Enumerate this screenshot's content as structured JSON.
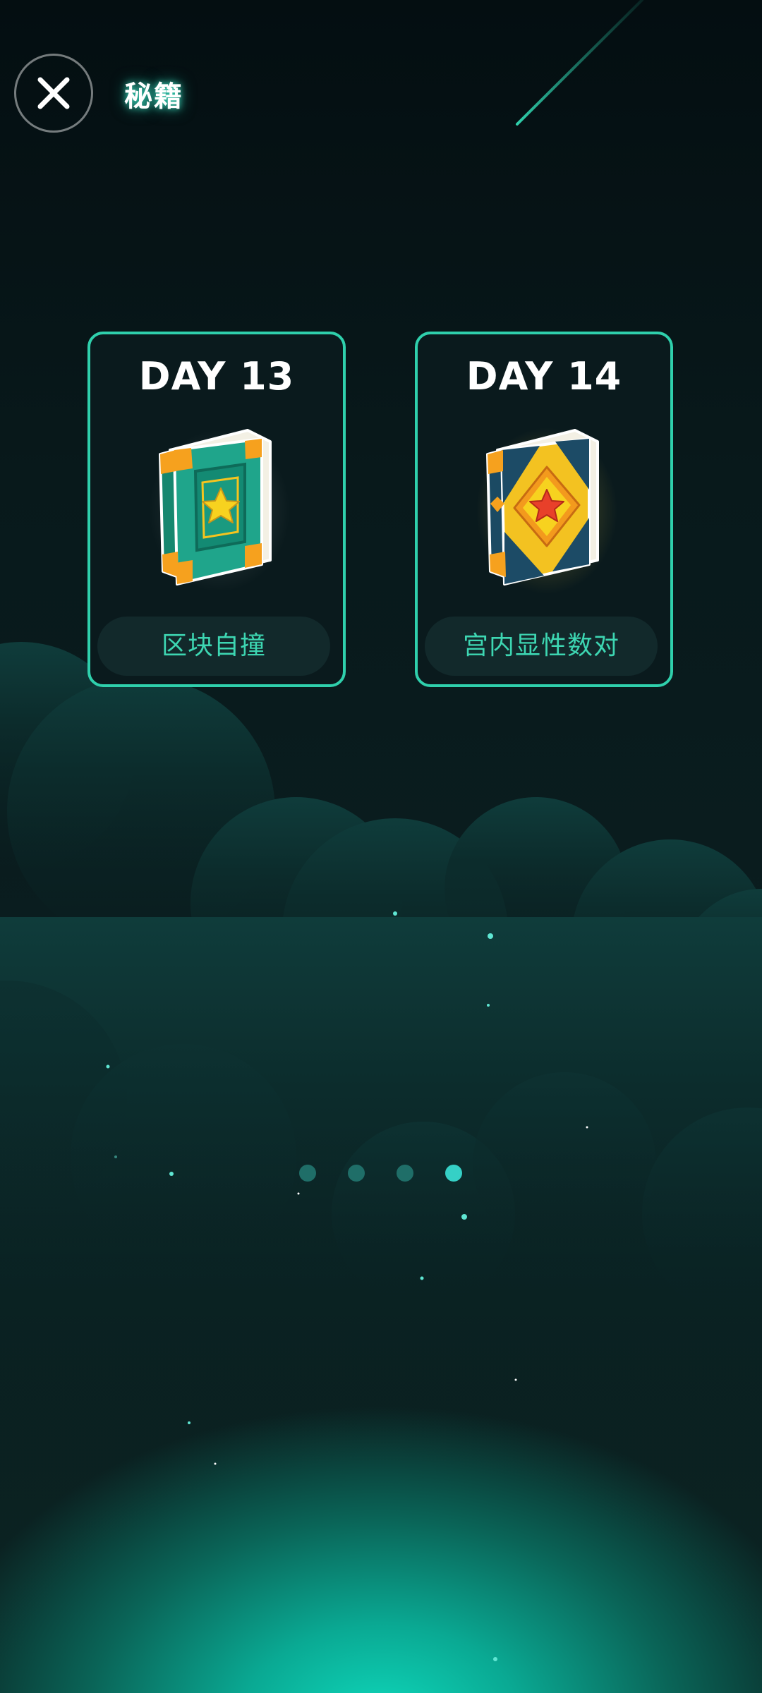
{
  "header": {
    "close_icon": "close-icon",
    "title": "秘籍"
  },
  "cards": [
    {
      "day": "DAY 13",
      "label": "区块自撞",
      "icon": "green-star-book-icon"
    },
    {
      "day": "DAY 14",
      "label": "宫内显性数对",
      "icon": "gold-star-book-icon"
    }
  ],
  "pagination": {
    "total": 4,
    "active_index": 3
  },
  "colors": {
    "accent": "#2fd0ac",
    "label_text": "#3dd6b2",
    "dot_inactive": "#1f6e68",
    "dot_active": "#35d0c6"
  }
}
